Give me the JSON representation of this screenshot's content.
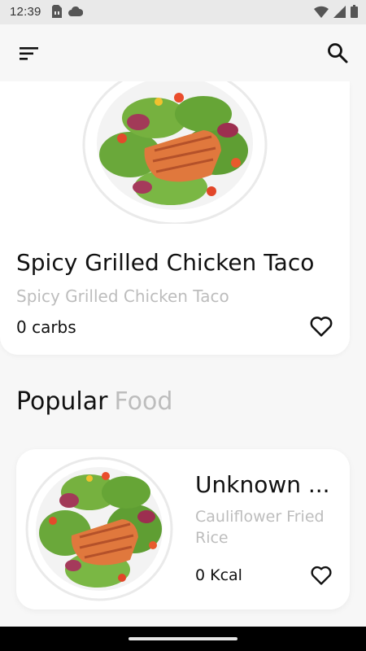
{
  "status_bar": {
    "time": "12:39",
    "left_icons": [
      "sim-card-icon",
      "cloud-icon"
    ],
    "right_icons": [
      "wifi-icon",
      "signal-icon",
      "battery-icon"
    ]
  },
  "app_bar": {
    "menu_icon": "menu-icon",
    "search_icon": "search-icon"
  },
  "featured": {
    "title": "Spicy Grilled Chicken Taco",
    "subtitle": "Spicy Grilled Chicken Taco",
    "carbs": "0 carbs",
    "favorite_icon": "heart-outline-icon"
  },
  "popular_section": {
    "heading_primary": "Popular",
    "heading_secondary": "Food"
  },
  "popular_items": [
    {
      "title": "Unknown ...",
      "subtitle": "Cauliflower Fried Rice",
      "kcal": "0 Kcal",
      "favorite_icon": "heart-outline-icon"
    }
  ],
  "colors": {
    "background": "#f7f7f7",
    "card": "#ffffff",
    "text_primary": "#111111",
    "text_secondary": "#bdbdbd"
  }
}
